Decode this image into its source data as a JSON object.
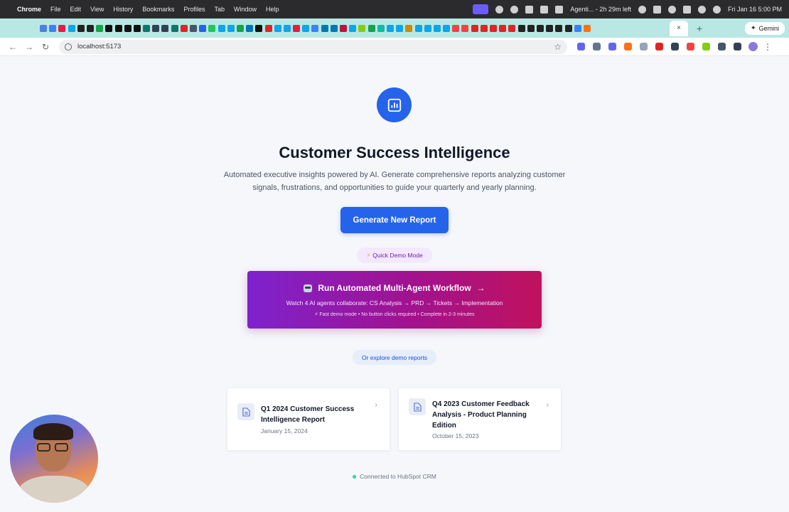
{
  "menubar": {
    "app": "Chrome",
    "items": [
      "File",
      "Edit",
      "View",
      "History",
      "Bookmarks",
      "Profiles",
      "Tab",
      "Window",
      "Help"
    ],
    "agent_status": "Agenti... - 2h 29m left",
    "clock": "Fri Jan 16  5:00 PM"
  },
  "tabstrip": {
    "gemini_label": "Gemini",
    "close_glyph": "×",
    "new_tab_glyph": "+",
    "favicon_colors": [
      "#4f7fe0",
      "#3b82f6",
      "#e11d48",
      "#0ea5e9",
      "#222222",
      "#222222",
      "#16a34a",
      "#111111",
      "#111111",
      "#111111",
      "#111111",
      "#0f766e",
      "#334155",
      "#334155",
      "#0f766e",
      "#dc2626",
      "#475569",
      "#2563eb",
      "#22c55e",
      "#0ea5e9",
      "#0ea5e9",
      "#16a34a",
      "#0077b5",
      "#111111",
      "#dc2626",
      "#0ea5e9",
      "#0ea5e9",
      "#e11d48",
      "#0ea5e9",
      "#3b82f6",
      "#0077b5",
      "#0077b5",
      "#be123c",
      "#0ea5e9",
      "#84cc16",
      "#16a34a",
      "#14b8a6",
      "#0ea5e9",
      "#0ea5e9",
      "#ca8a04",
      "#0ea5e9",
      "#0ea5e9",
      "#0ea5e9",
      "#0ea5e9",
      "#ef4444",
      "#ef4444",
      "#dc2626",
      "#dc2626",
      "#dc2626",
      "#dc2626",
      "#dc2626",
      "#222222",
      "#222222",
      "#222222",
      "#222222",
      "#222222",
      "#222222",
      "#3b82f6",
      "#f97316"
    ]
  },
  "toolbar": {
    "back": "←",
    "forward": "→",
    "reload": "↻",
    "url": "localhost:5173",
    "star": "☆",
    "kebab": "⋮",
    "ext_colors": [
      "#6366f1",
      "#64748b",
      "#6366f1",
      "#f97316",
      "#94a3b8",
      "#dc2626",
      "#334155",
      "#ef4444",
      "#84cc16",
      "#475569",
      "#334155"
    ]
  },
  "hero": {
    "title": "Customer Success Intelligence",
    "subtitle": "Automated executive insights powered by AI. Generate comprehensive reports analyzing customer signals, frustrations, and opportunities to guide your quarterly and yearly planning.",
    "primary_button": "Generate New Report"
  },
  "demo": {
    "badge_icon": "⚡",
    "badge_label": "Quick Demo Mode",
    "workflow_title": "Run Automated Multi-Agent Workflow",
    "workflow_arrow": "→",
    "workflow_subtitle": "Watch 4 AI agents collaborate: CS Analysis → PRD → Tickets → Implementation",
    "workflow_note": "⚡ Fast demo mode • No button clicks required • Complete in 2-3 minutes",
    "explore_label": "Or explore demo reports"
  },
  "reports": [
    {
      "title": "Q1 2024 Customer Success Intelligence Report",
      "date": "January 15, 2024"
    },
    {
      "title": "Q4 2023 Customer Feedback Analysis - Product Planning Edition",
      "date": "October 15, 2023"
    }
  ],
  "footer": {
    "crm_status": "Connected to HubSpot CRM",
    "status_color": "#34d399"
  },
  "colors": {
    "brand_blue": "#2563eb",
    "workflow_gradient_start": "#7e22ce",
    "workflow_gradient_end": "#c0125d",
    "tabstrip_bg": "#b9e7e4"
  }
}
